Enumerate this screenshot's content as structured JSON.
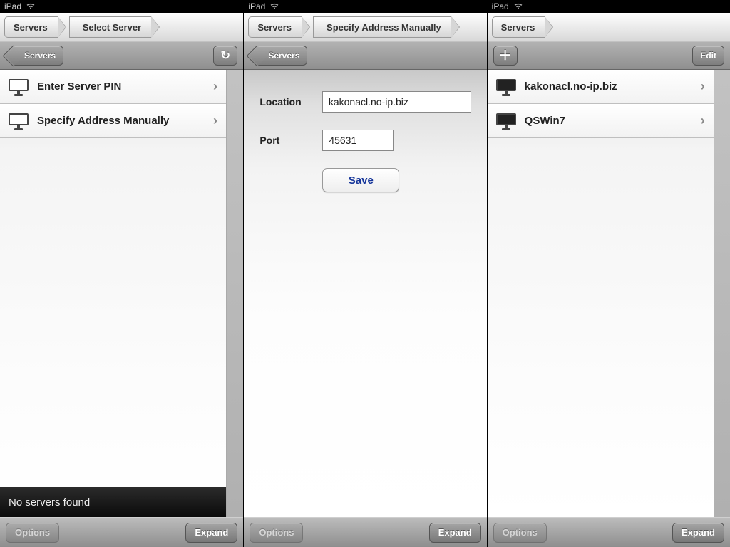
{
  "status": {
    "device": "iPad"
  },
  "panes": [
    {
      "breadcrumb": [
        "Servers",
        "Select Server"
      ],
      "subbar": {
        "back": "Servers",
        "hasRefresh": true
      },
      "rows": [
        {
          "label": "Enter Server PIN"
        },
        {
          "label": "Specify Address Manually"
        }
      ],
      "noServers": "No servers found",
      "bottom": {
        "options": "Options",
        "expand": "Expand"
      }
    },
    {
      "breadcrumb": [
        "Servers",
        "Specify Address Manually"
      ],
      "subbar": {
        "back": "Servers"
      },
      "form": {
        "locationLabel": "Location",
        "locationValue": "kakonacl.no-ip.biz",
        "portLabel": "Port",
        "portValue": "45631",
        "save": "Save"
      },
      "bottom": {
        "options": "Options",
        "expand": "Expand"
      }
    },
    {
      "breadcrumb": [
        "Servers"
      ],
      "subbar": {
        "hasPlus": true,
        "edit": "Edit"
      },
      "servers": [
        {
          "name": "kakonacl.no-ip.biz"
        },
        {
          "name": "QSWin7"
        }
      ],
      "bottom": {
        "options": "Options",
        "expand": "Expand"
      }
    }
  ]
}
